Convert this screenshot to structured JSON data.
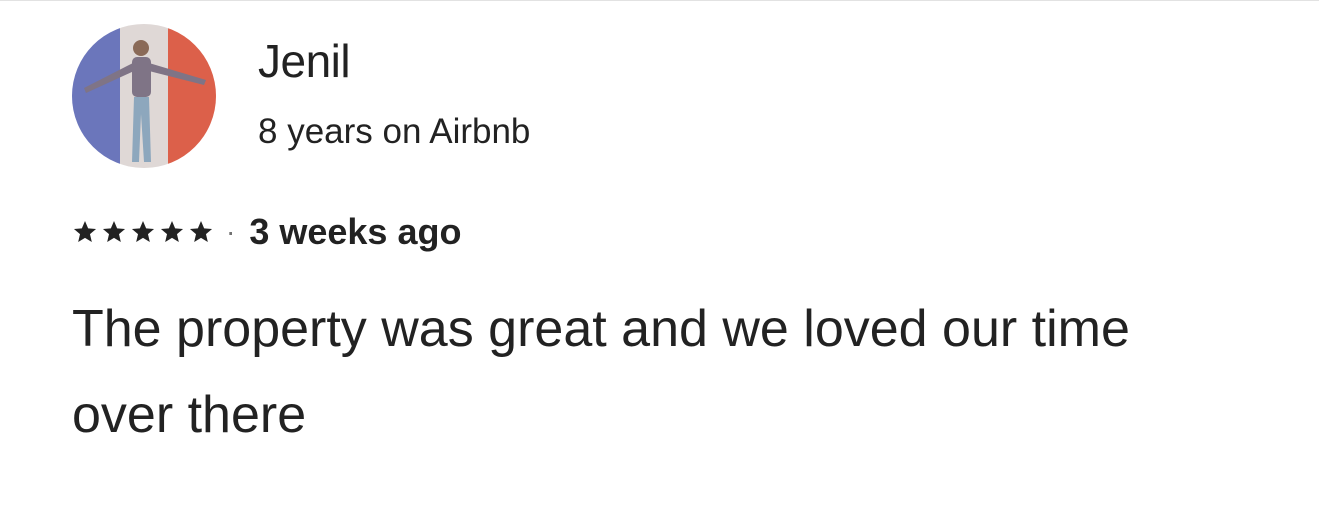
{
  "reviewer": {
    "name": "Jenil",
    "tenure": "8 years on Airbnb",
    "avatar_icon": "profile-photo"
  },
  "review": {
    "rating": 5,
    "rating_max": 5,
    "separator": "·",
    "age": "3 weeks ago",
    "text": "The property was great and we loved our time over there"
  },
  "colors": {
    "text": "#222222",
    "muted": "#717171",
    "divider": "#e2e2e2",
    "flag_blue": "#5b6ec9",
    "flag_white": "#e8e6ea",
    "flag_red": "#e5533f"
  }
}
